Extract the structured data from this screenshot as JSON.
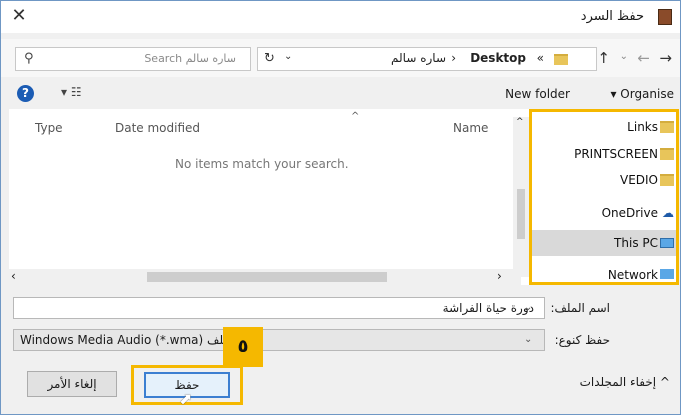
{
  "window": {
    "title": "حفظ السرد",
    "close_glyph": "✕"
  },
  "address_bar": {
    "search_placeholder": "Search ساره سالم",
    "crumb_overflow": "«",
    "crumb_desktop": "Desktop",
    "crumb_sep": "›",
    "crumb_user": "ساره سالم",
    "refresh_glyph": "↻",
    "dropdown_glyph": "⌄"
  },
  "toolbar": {
    "new_folder": "New folder",
    "organise": "▾ Organise",
    "help": "?"
  },
  "columns": {
    "name": "Name",
    "date_modified": "Date modified",
    "type": "Type"
  },
  "empty_message": "No items match your search.",
  "nav": {
    "items": [
      {
        "label": "Links",
        "icon": "folder-icon"
      },
      {
        "label": "PRINTSCREEN",
        "icon": "folder-icon"
      },
      {
        "label": "VEDIO",
        "icon": "folder-icon"
      },
      {
        "label": "OneDrive",
        "icon": "onedrive-icon"
      },
      {
        "label": "This PC",
        "icon": "computer-icon"
      },
      {
        "label": "Network",
        "icon": "network-icon"
      }
    ],
    "selected": "This PC"
  },
  "form": {
    "file_name_label": "اسم الملف:",
    "file_name_value": "دورة حياة الفراشة",
    "save_as_type_label": "حفظ كنوع:",
    "save_as_type_value": "ملف Windows Media Audio (*.wma)"
  },
  "footer": {
    "hide_folders": "^ إخفاء المجلدات",
    "save": "حفظ",
    "cancel": "إلغاء الأمر"
  },
  "annotation": {
    "step_number": "٥"
  },
  "colors": {
    "highlight": "#f5b800",
    "accent": "#3c7fd1",
    "selected": "#d9d9d9"
  }
}
